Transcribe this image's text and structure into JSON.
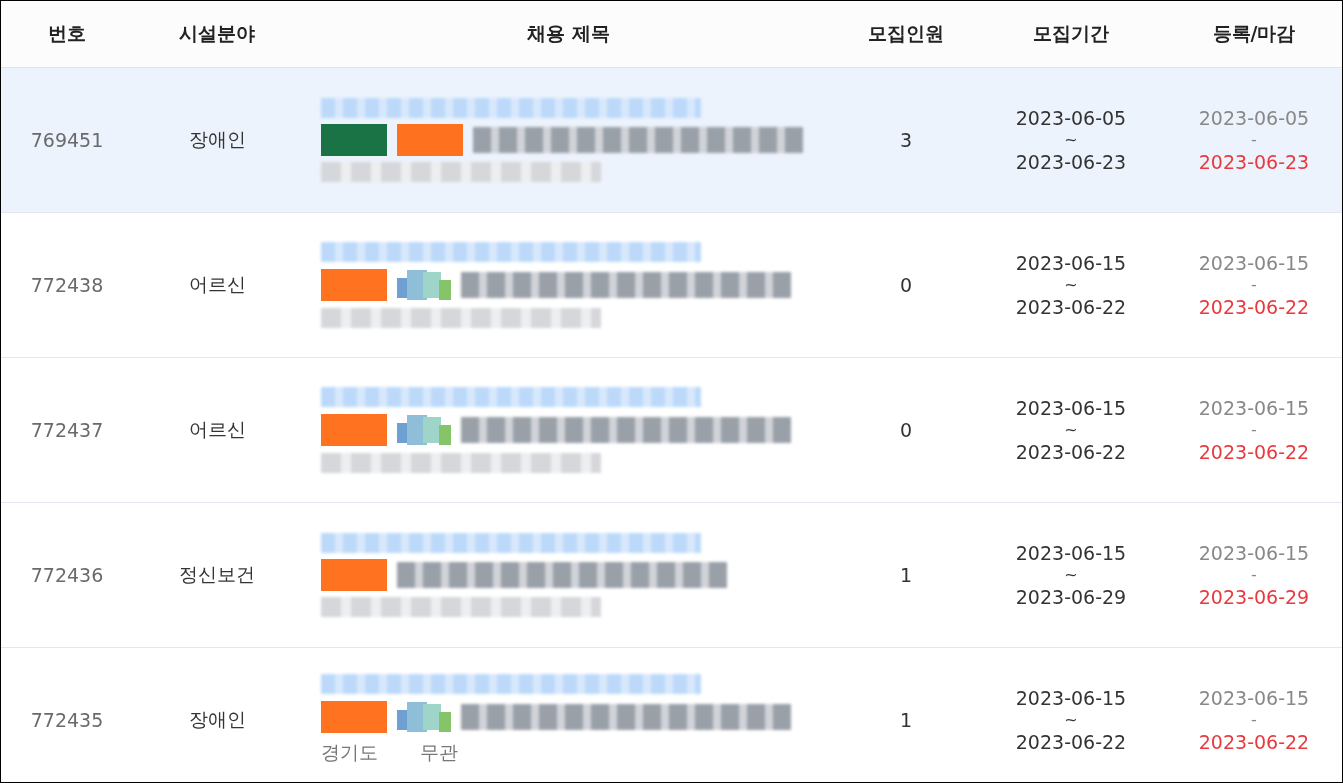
{
  "columns": [
    "번호",
    "시설분야",
    "채용 제목",
    "모집인원",
    "모집기간",
    "등록/마감"
  ],
  "rows": [
    {
      "id": "769451",
      "field": "장애인",
      "badges": [
        {
          "color": "#0f6b3a"
        },
        {
          "color": "#ff6a13"
        }
      ],
      "logo": false,
      "count": "3",
      "period_start": "2023-06-05",
      "period_sep": "~",
      "period_end": "2023-06-23",
      "registered": "2023-06-05",
      "date_sep": "-",
      "deadline": "2023-06-23",
      "selected": true
    },
    {
      "id": "772438",
      "field": "어르신",
      "badges": [
        {
          "color": "#ff6a13"
        }
      ],
      "logo": true,
      "count": "0",
      "period_start": "2023-06-15",
      "period_sep": "~",
      "period_end": "2023-06-22",
      "registered": "2023-06-15",
      "date_sep": "-",
      "deadline": "2023-06-22",
      "selected": false
    },
    {
      "id": "772437",
      "field": "어르신",
      "badges": [
        {
          "color": "#ff6a13"
        }
      ],
      "logo": true,
      "count": "0",
      "period_start": "2023-06-15",
      "period_sep": "~",
      "period_end": "2023-06-22",
      "registered": "2023-06-15",
      "date_sep": "-",
      "deadline": "2023-06-22",
      "selected": false
    },
    {
      "id": "772436",
      "field": "정신보건",
      "badges": [
        {
          "color": "#ff6a13"
        }
      ],
      "logo": false,
      "count": "1",
      "period_start": "2023-06-15",
      "period_sep": "~",
      "period_end": "2023-06-29",
      "registered": "2023-06-15",
      "date_sep": "-",
      "deadline": "2023-06-29",
      "selected": false
    },
    {
      "id": "772435",
      "field": "장애인",
      "badges": [
        {
          "color": "#ff6a13"
        }
      ],
      "logo": true,
      "count": "1",
      "period_start": "2023-06-15",
      "period_sep": "~",
      "period_end": "2023-06-22",
      "registered": "2023-06-15",
      "date_sep": "-",
      "deadline": "2023-06-22",
      "selected": false,
      "meta": [
        "경기도",
        "무관"
      ]
    }
  ]
}
